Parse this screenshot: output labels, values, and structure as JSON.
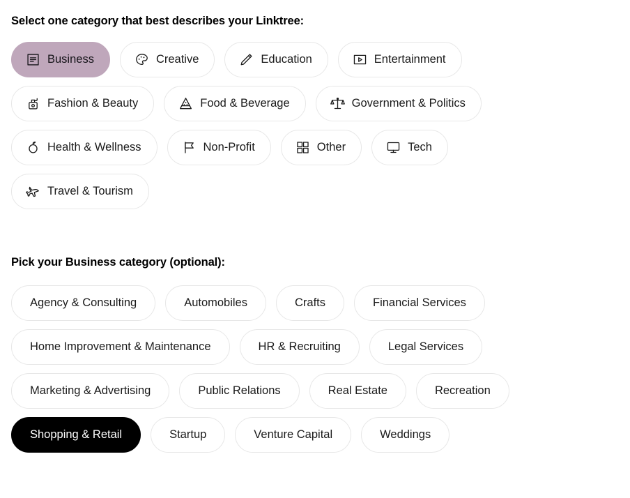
{
  "primary_section": {
    "heading": "Select one category that best describes your Linktree:",
    "selected": "Business",
    "selected_color": "#bfa7bb",
    "chips": [
      {
        "label": "Business",
        "icon": "document-lines-icon",
        "selected": true
      },
      {
        "label": "Creative",
        "icon": "palette-icon",
        "selected": false
      },
      {
        "label": "Education",
        "icon": "pencil-icon",
        "selected": false
      },
      {
        "label": "Entertainment",
        "icon": "play-box-icon",
        "selected": false
      },
      {
        "label": "Fashion & Beauty",
        "icon": "perfume-bottle-icon",
        "selected": false
      },
      {
        "label": "Food & Beverage",
        "icon": "pizza-slice-icon",
        "selected": false
      },
      {
        "label": "Government & Politics",
        "icon": "scales-icon",
        "selected": false
      },
      {
        "label": "Health & Wellness",
        "icon": "apple-icon",
        "selected": false
      },
      {
        "label": "Non-Profit",
        "icon": "flag-icon",
        "selected": false
      },
      {
        "label": "Other",
        "icon": "grid-squares-icon",
        "selected": false
      },
      {
        "label": "Tech",
        "icon": "monitor-icon",
        "selected": false
      },
      {
        "label": "Travel & Tourism",
        "icon": "airplane-icon",
        "selected": false
      }
    ]
  },
  "secondary_section": {
    "heading": "Pick your Business category (optional):",
    "selected": "Shopping & Retail",
    "selected_color": "#000000",
    "chips": [
      {
        "label": "Agency & Consulting",
        "selected": false
      },
      {
        "label": "Automobiles",
        "selected": false
      },
      {
        "label": "Crafts",
        "selected": false
      },
      {
        "label": "Financial Services",
        "selected": false
      },
      {
        "label": "Home Improvement & Maintenance",
        "selected": false
      },
      {
        "label": "HR & Recruiting",
        "selected": false
      },
      {
        "label": "Legal Services",
        "selected": false
      },
      {
        "label": "Marketing & Advertising",
        "selected": false
      },
      {
        "label": "Public Relations",
        "selected": false
      },
      {
        "label": "Real Estate",
        "selected": false
      },
      {
        "label": "Recreation",
        "selected": false
      },
      {
        "label": "Shopping & Retail",
        "selected": true
      },
      {
        "label": "Startup",
        "selected": false
      },
      {
        "label": "Venture Capital",
        "selected": false
      },
      {
        "label": "Weddings",
        "selected": false
      }
    ]
  }
}
